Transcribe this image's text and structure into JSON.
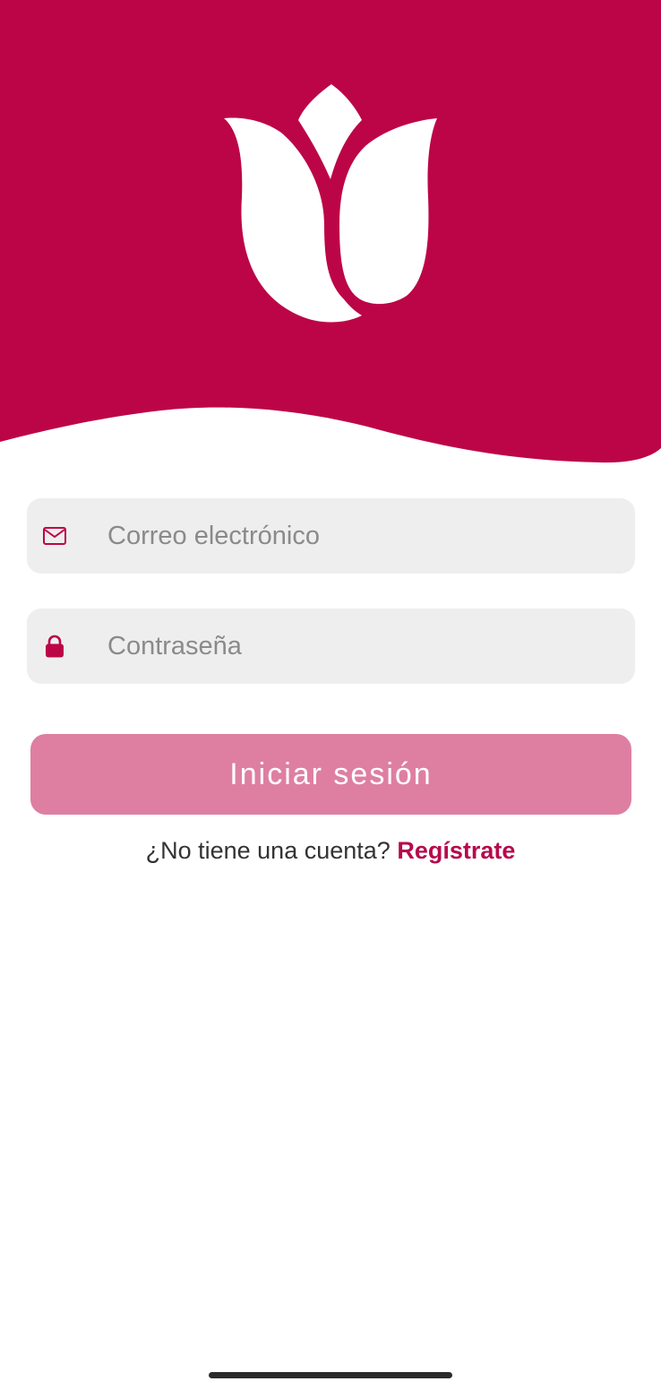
{
  "colors": {
    "brand": "#bc0547",
    "button": "#de7fa2",
    "link": "#b60a4c",
    "field_bg": "#eeeeee"
  },
  "header": {
    "logo_icon": "tulip-icon"
  },
  "form": {
    "email": {
      "icon": "mail-icon",
      "placeholder": "Correo electrónico",
      "value": ""
    },
    "password": {
      "icon": "lock-icon",
      "placeholder": "Contraseña",
      "value": ""
    },
    "login_label": "Iniciar sesión"
  },
  "signup": {
    "prompt": "¿No tiene una cuenta?",
    "link_label": "Regístrate"
  }
}
